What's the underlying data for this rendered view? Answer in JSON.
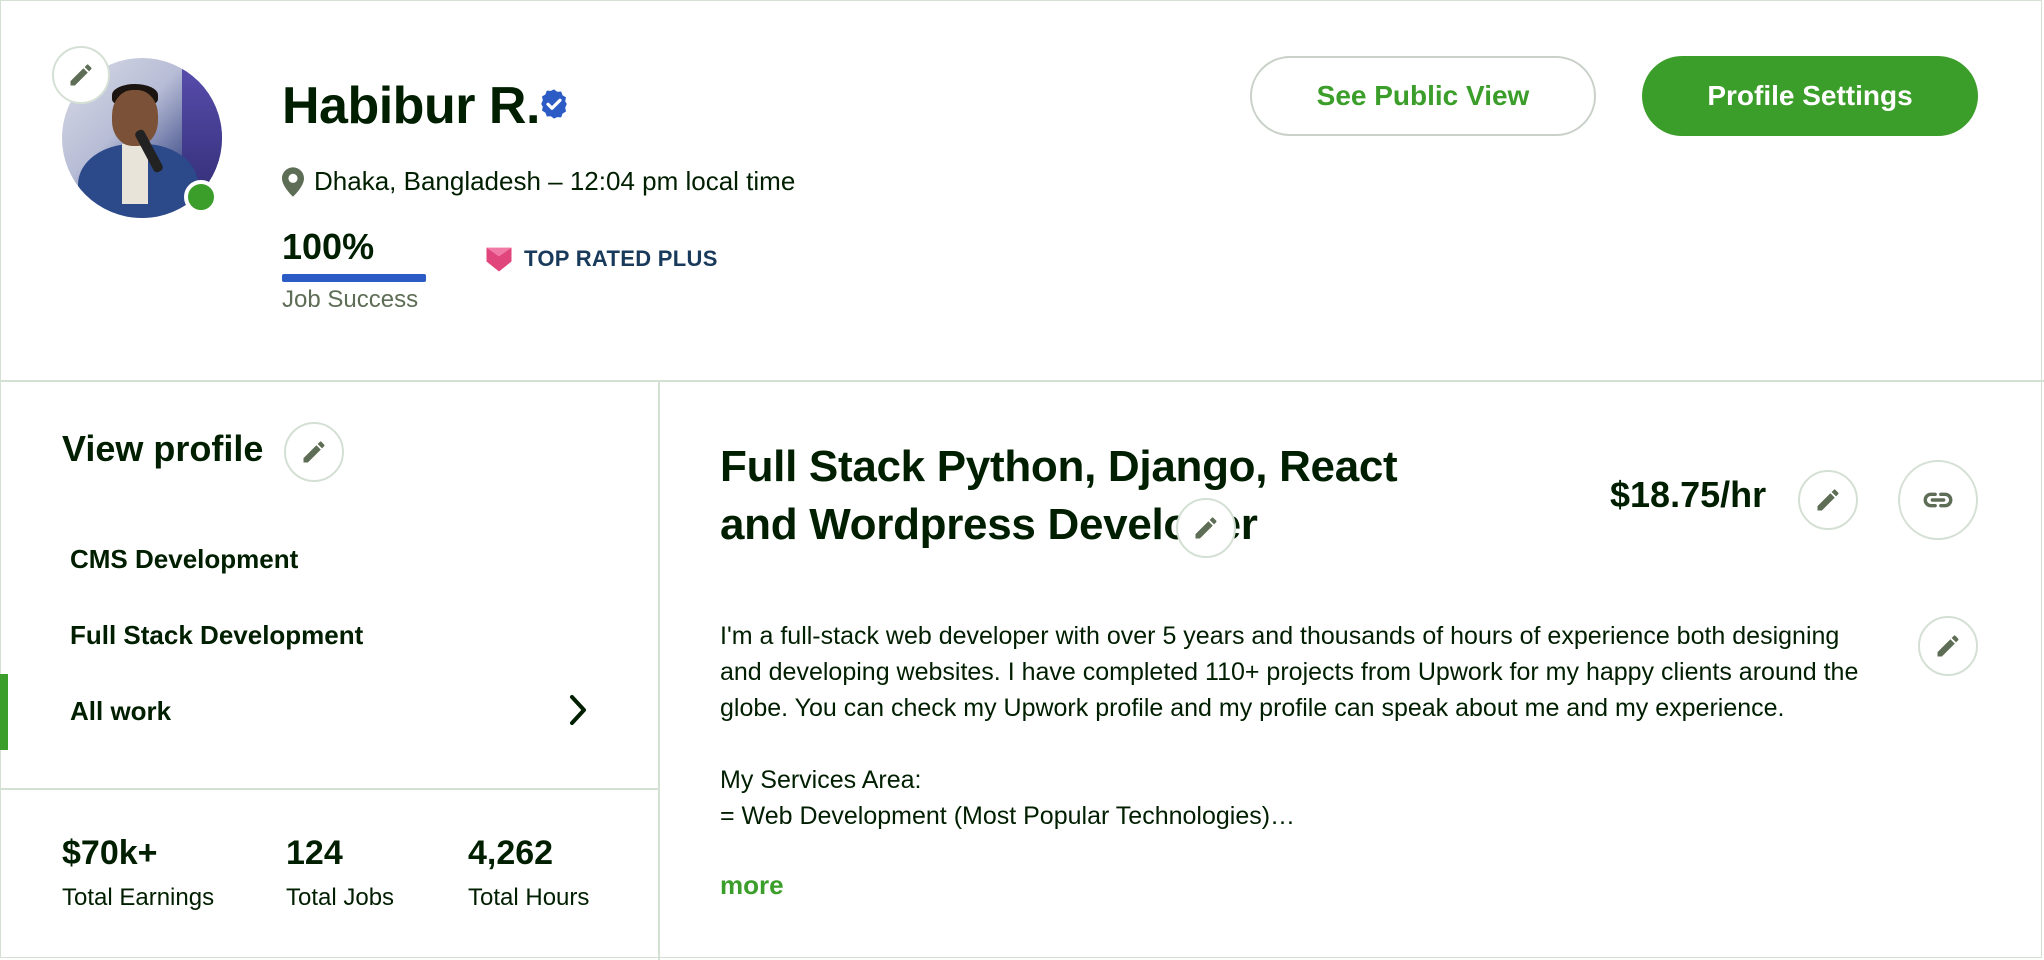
{
  "profile": {
    "name": "Habibur R.",
    "location": "Dhaka, Bangladesh – 12:04 pm local time",
    "job_success_value": "100%",
    "job_success_fraction": 1.0,
    "job_success_label": "Job Success",
    "badge_label": "TOP RATED PLUS"
  },
  "header": {
    "see_public_view_label": "See Public View",
    "profile_settings_label": "Profile Settings"
  },
  "sidebar": {
    "view_profile_title": "View profile",
    "items": [
      {
        "label": "CMS Development",
        "active": false
      },
      {
        "label": "Full Stack Development",
        "active": false
      },
      {
        "label": "All work",
        "active": true
      }
    ]
  },
  "stats": [
    {
      "value": "$70k+",
      "label": "Total Earnings"
    },
    {
      "value": "124",
      "label": "Total Jobs"
    },
    {
      "value": "4,262",
      "label": "Total Hours"
    }
  ],
  "main": {
    "title": "Full Stack Python, Django, React and Wordpress Developer",
    "rate": "$18.75/hr",
    "description_p1": "I'm a full-stack web developer with over 5 years and thousands of hours of experience both designing and developing websites. I have completed 110+ projects from Upwork for my happy clients around the globe. You can check my Upwork profile and my profile can speak about me and my experience.",
    "description_p2": "My Services Area:",
    "description_p3": "= Web Development (Most Popular Technologies)…",
    "more_label": "more"
  },
  "colors": {
    "accent_green": "#3c9e2a",
    "job_success_blue": "#2d5bc6",
    "badge_pink": "#e0457b",
    "verified_blue": "#2d5bc6"
  },
  "icons": {
    "edit": "pencil-icon",
    "verified": "verified-badge-icon",
    "location": "location-pin-icon",
    "link": "link-icon",
    "chevron": "chevron-right-icon",
    "badge": "top-rated-plus-icon"
  }
}
